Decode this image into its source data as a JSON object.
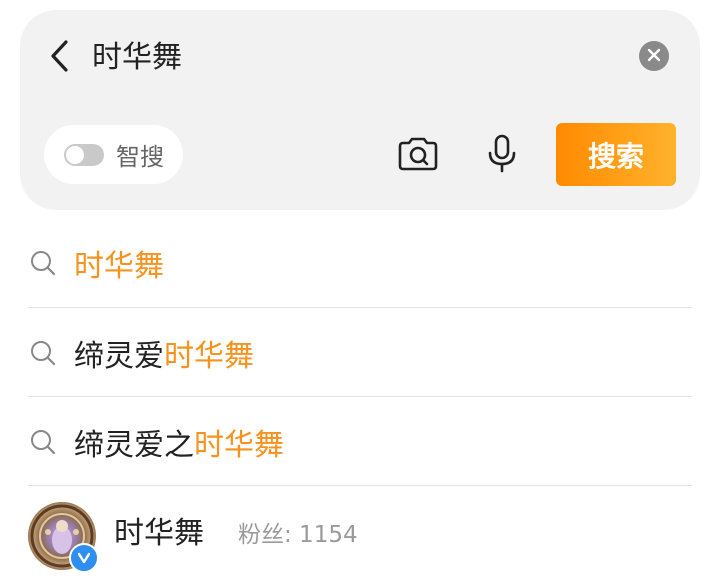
{
  "search": {
    "query": "时华舞",
    "smart_search_label": "智搜",
    "smart_search_on": false,
    "search_button_label": "搜索",
    "icons": {
      "back": "chevron-left-icon",
      "clear": "clear-circle-icon",
      "camera": "camera-scan-icon",
      "mic": "microphone-icon"
    }
  },
  "suggestions": [
    {
      "prefix": "",
      "highlight": "时华舞"
    },
    {
      "prefix": "缔灵爱",
      "highlight": "时华舞"
    },
    {
      "prefix": "缔灵爱之",
      "highlight": "时华舞"
    }
  ],
  "user_result": {
    "name": "时华舞",
    "followers": "粉丝: 1154",
    "verified": true
  },
  "colors": {
    "accent": "#f5931e",
    "search_button_start": "#ff8a00",
    "search_button_end": "#ffb22c",
    "card_bg": "#f2f2f2",
    "verified": "#2f8ff0"
  }
}
